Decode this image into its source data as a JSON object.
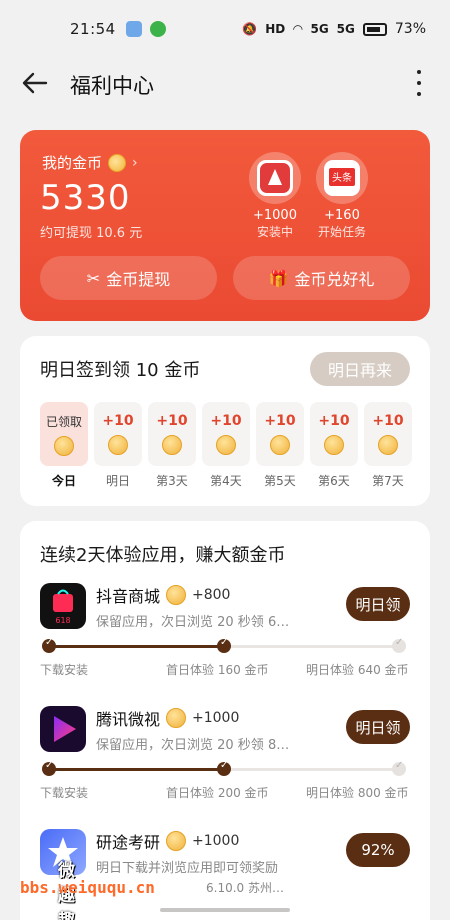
{
  "status": {
    "time": "21:54",
    "battery": "73%",
    "network1": "5G",
    "network2": "5G"
  },
  "header": {
    "title": "福利中心"
  },
  "coins": {
    "label": "我的金币",
    "balance": "5330",
    "withdraw_estimate": "约可提现 10.6 元",
    "apps": [
      {
        "reward": "+1000",
        "status": "安装中",
        "name": "百度极速"
      },
      {
        "reward": "+160",
        "status": "开始任务",
        "name": "头条"
      }
    ],
    "withdraw_button": "金币提现",
    "gift_button": "金币兑好礼"
  },
  "signin": {
    "title": "明日签到领 10 金币",
    "button": "明日再来",
    "days": [
      {
        "amount": "已领取",
        "label": "今日",
        "done": true
      },
      {
        "amount": "+10",
        "label": "明日"
      },
      {
        "amount": "+10",
        "label": "第3天"
      },
      {
        "amount": "+10",
        "label": "第4天"
      },
      {
        "amount": "+10",
        "label": "第5天"
      },
      {
        "amount": "+10",
        "label": "第6天"
      },
      {
        "amount": "+10",
        "label": "第7天"
      }
    ]
  },
  "apps_section": {
    "title": "连续2天体验应用，赚大额金币",
    "items": [
      {
        "name": "抖音商城",
        "reward": "+800",
        "desc": "保留应用，次日浏览 20 秒领 6…",
        "action": "明日领",
        "steps": [
          "下载安装",
          "首日体验 160 金币",
          "明日体验 640 金币"
        ],
        "progress": 0.5
      },
      {
        "name": "腾讯微视",
        "reward": "+1000",
        "desc": "保留应用，次日浏览 20 秒领 8…",
        "action": "明日领",
        "steps": [
          "下载安装",
          "首日体验 200 金币",
          "明日体验 800 金币"
        ],
        "progress": 0.5
      },
      {
        "name": "研途考研",
        "reward": "+1000",
        "desc": "明日下载并浏览应用即可领奖励",
        "action": "92%",
        "meta": "6.10.0   苏州…"
      }
    ]
  },
  "watermark": {
    "text": "bbs.weiququ.cn",
    "brand": "微趣趣"
  }
}
